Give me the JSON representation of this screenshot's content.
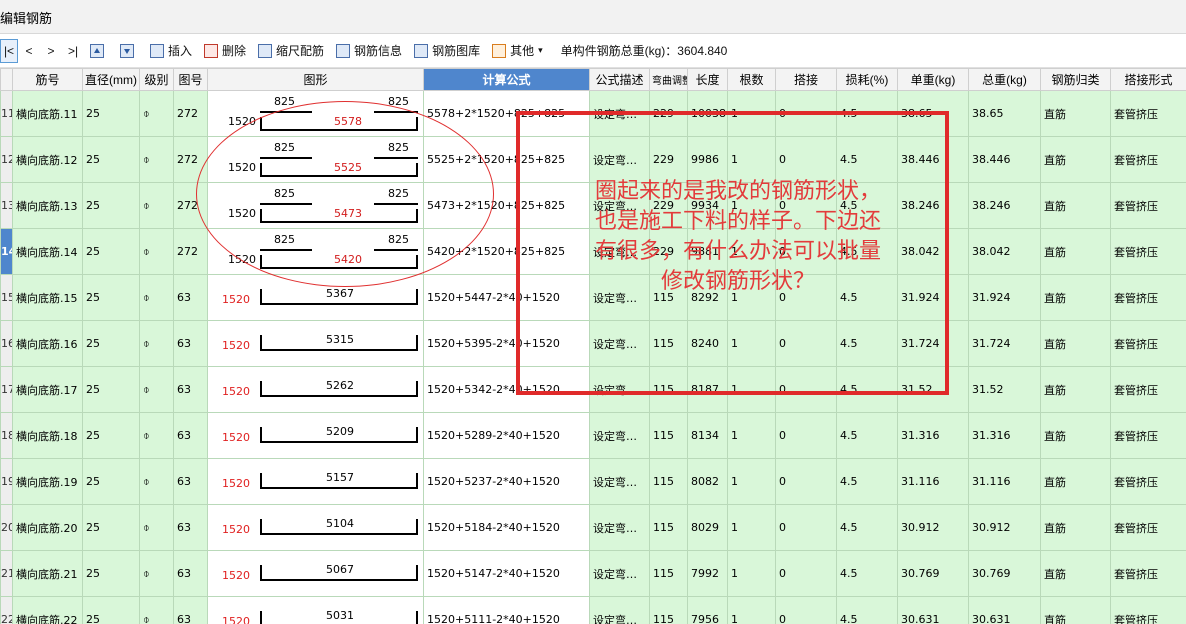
{
  "window": {
    "title": "编辑钢筋"
  },
  "toolbar": {
    "nav": [
      "|<",
      "<",
      ">",
      ">|"
    ],
    "insert": "插入",
    "delete": "删除",
    "scale": "缩尺配筋",
    "rebar_info": "钢筋信息",
    "rebar_lib": "钢筋图库",
    "other": "其他",
    "total_weight": "单构件钢筋总重(kg)：3604.840"
  },
  "columns": [
    "筋号",
    "直径(mm)",
    "级别",
    "图号",
    "图形",
    "计算公式",
    "公式描述",
    "弯曲调整",
    "长度",
    "根数",
    "搭接",
    "损耗(%)",
    "单重(kg)",
    "总重(kg)",
    "钢筋归类",
    "搭接形式"
  ],
  "rows": [
    {
      "num": "11",
      "name": "横向底筋.11",
      "dia": "25",
      "grade": "⌽",
      "fig": "272",
      "shape": "a",
      "hl": "825",
      "hr": "825",
      "left": "1520",
      "bottom": "5578",
      "formula": "5578+2*1520+825+825",
      "desc": "设定弯…",
      "adj": "229",
      "len": "10038",
      "count": "1",
      "lap": "0",
      "loss": "4.5",
      "unit": "38.65",
      "total": "38.65",
      "cat": "直筋",
      "lapt": "套管挤压"
    },
    {
      "num": "12",
      "name": "横向底筋.12",
      "dia": "25",
      "grade": "⌽",
      "fig": "272",
      "shape": "a",
      "hl": "825",
      "hr": "825",
      "left": "1520",
      "bottom": "5525",
      "formula": "5525+2*1520+825+825",
      "desc": "设定弯…",
      "adj": "229",
      "len": "9986",
      "count": "1",
      "lap": "0",
      "loss": "4.5",
      "unit": "38.446",
      "total": "38.446",
      "cat": "直筋",
      "lapt": "套管挤压"
    },
    {
      "num": "13",
      "name": "横向底筋.13",
      "dia": "25",
      "grade": "⌽",
      "fig": "272",
      "shape": "a",
      "hl": "825",
      "hr": "825",
      "left": "1520",
      "bottom": "5473",
      "formula": "5473+2*1520+825+825",
      "desc": "设定弯…",
      "adj": "229",
      "len": "9934",
      "count": "1",
      "lap": "0",
      "loss": "4.5",
      "unit": "38.246",
      "total": "38.246",
      "cat": "直筋",
      "lapt": "套管挤压"
    },
    {
      "num": "14",
      "name": "横向底筋.14",
      "dia": "25",
      "grade": "⌽",
      "fig": "272",
      "shape": "a",
      "hl": "825",
      "hr": "825",
      "left": "1520",
      "bottom": "5420",
      "formula": "5420+2*1520+825+825",
      "desc": "设定弯…",
      "adj": "229",
      "len": "9881",
      "count": "1",
      "lap": "0",
      "loss": "4.5",
      "unit": "38.042",
      "total": "38.042",
      "cat": "直筋",
      "lapt": "套管挤压",
      "selected": true
    },
    {
      "num": "15",
      "name": "横向底筋.15",
      "dia": "25",
      "grade": "⌽",
      "fig": "63",
      "shape": "b",
      "left": "1520",
      "bottom": "5367",
      "formula": "1520+5447-2*40+1520",
      "desc": "设定弯…",
      "adj": "115",
      "len": "8292",
      "count": "1",
      "lap": "0",
      "loss": "4.5",
      "unit": "31.924",
      "total": "31.924",
      "cat": "直筋",
      "lapt": "套管挤压"
    },
    {
      "num": "16",
      "name": "横向底筋.16",
      "dia": "25",
      "grade": "⌽",
      "fig": "63",
      "shape": "b",
      "left": "1520",
      "bottom": "5315",
      "formula": "1520+5395-2*40+1520",
      "desc": "设定弯…",
      "adj": "115",
      "len": "8240",
      "count": "1",
      "lap": "0",
      "loss": "4.5",
      "unit": "31.724",
      "total": "31.724",
      "cat": "直筋",
      "lapt": "套管挤压"
    },
    {
      "num": "17",
      "name": "横向底筋.17",
      "dia": "25",
      "grade": "⌽",
      "fig": "63",
      "shape": "b",
      "left": "1520",
      "bottom": "5262",
      "formula": "1520+5342-2*40+1520",
      "desc": "设定弯…",
      "adj": "115",
      "len": "8187",
      "count": "1",
      "lap": "0",
      "loss": "4.5",
      "unit": "31.52",
      "total": "31.52",
      "cat": "直筋",
      "lapt": "套管挤压"
    },
    {
      "num": "18",
      "name": "横向底筋.18",
      "dia": "25",
      "grade": "⌽",
      "fig": "63",
      "shape": "b",
      "left": "1520",
      "bottom": "5209",
      "formula": "1520+5289-2*40+1520",
      "desc": "设定弯…",
      "adj": "115",
      "len": "8134",
      "count": "1",
      "lap": "0",
      "loss": "4.5",
      "unit": "31.316",
      "total": "31.316",
      "cat": "直筋",
      "lapt": "套管挤压"
    },
    {
      "num": "19",
      "name": "横向底筋.19",
      "dia": "25",
      "grade": "⌽",
      "fig": "63",
      "shape": "b",
      "left": "1520",
      "bottom": "5157",
      "formula": "1520+5237-2*40+1520",
      "desc": "设定弯…",
      "adj": "115",
      "len": "8082",
      "count": "1",
      "lap": "0",
      "loss": "4.5",
      "unit": "31.116",
      "total": "31.116",
      "cat": "直筋",
      "lapt": "套管挤压"
    },
    {
      "num": "20",
      "name": "横向底筋.20",
      "dia": "25",
      "grade": "⌽",
      "fig": "63",
      "shape": "b",
      "left": "1520",
      "bottom": "5104",
      "formula": "1520+5184-2*40+1520",
      "desc": "设定弯…",
      "adj": "115",
      "len": "8029",
      "count": "1",
      "lap": "0",
      "loss": "4.5",
      "unit": "30.912",
      "total": "30.912",
      "cat": "直筋",
      "lapt": "套管挤压"
    },
    {
      "num": "21",
      "name": "横向底筋.21",
      "dia": "25",
      "grade": "⌽",
      "fig": "63",
      "shape": "b",
      "left": "1520",
      "bottom": "5067",
      "formula": "1520+5147-2*40+1520",
      "desc": "设定弯…",
      "adj": "115",
      "len": "7992",
      "count": "1",
      "lap": "0",
      "loss": "4.5",
      "unit": "30.769",
      "total": "30.769",
      "cat": "直筋",
      "lapt": "套管挤压"
    },
    {
      "num": "22",
      "name": "横向底筋.22",
      "dia": "25",
      "grade": "⌽",
      "fig": "63",
      "shape": "b",
      "left": "1520",
      "bottom": "5031",
      "formula": "1520+5111-2*40+1520",
      "desc": "设定弯…",
      "adj": "115",
      "len": "7956",
      "count": "1",
      "lap": "0",
      "loss": "4.5",
      "unit": "30.631",
      "total": "30.631",
      "cat": "直筋",
      "lapt": "套管挤压"
    }
  ],
  "annotation": {
    "lines": [
      "圈起来的是我改的钢筋形状，",
      "也是施工下料的样子。下边还",
      "有很多，有什么办法可以批量",
      "修改钢筋形状？"
    ]
  },
  "colors": {
    "row_bg": "#d9f7d9",
    "header_highlight": "#4f86cd",
    "annotation": "#e02a2a"
  }
}
